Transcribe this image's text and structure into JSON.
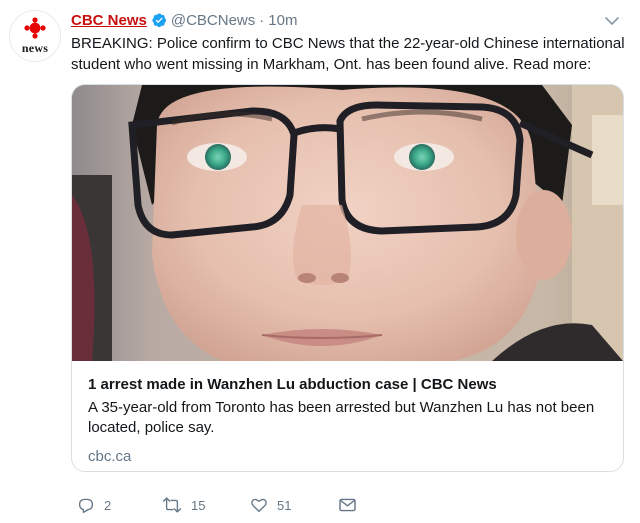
{
  "tweet": {
    "display_name": "CBC News",
    "handle": "@CBCNews",
    "separator": "·",
    "time": "10m",
    "text": "BREAKING: Police confirm to CBC News that the 22-year-old Chinese international student who went missing in Markham, Ont. has been found alive. Read more:",
    "avatar": {
      "label": "news",
      "icon": "cbc-gem-logo",
      "brand_color": "#e60505"
    },
    "verified_icon": "verified-badge-icon",
    "verified_color": "#1da1f2",
    "menu_icon": "chevron-down-icon"
  },
  "card": {
    "image_icon": "article-photo",
    "title": "1 arrest made in Wanzhen Lu abduction case | CBC News",
    "description": "A 35-year-old from Toronto has been arrested but Wanzhen Lu has not been located, police say.",
    "domain": "cbc.ca"
  },
  "actions": {
    "reply": {
      "icon": "reply-icon",
      "count": "2"
    },
    "retweet": {
      "icon": "retweet-icon",
      "count": "15"
    },
    "like": {
      "icon": "heart-icon",
      "count": "51"
    },
    "message": {
      "icon": "direct-message-icon"
    }
  },
  "colors": {
    "name_red": "#c81010",
    "muted": "#657786",
    "text": "#14171a",
    "border": "#d8dfe5"
  }
}
